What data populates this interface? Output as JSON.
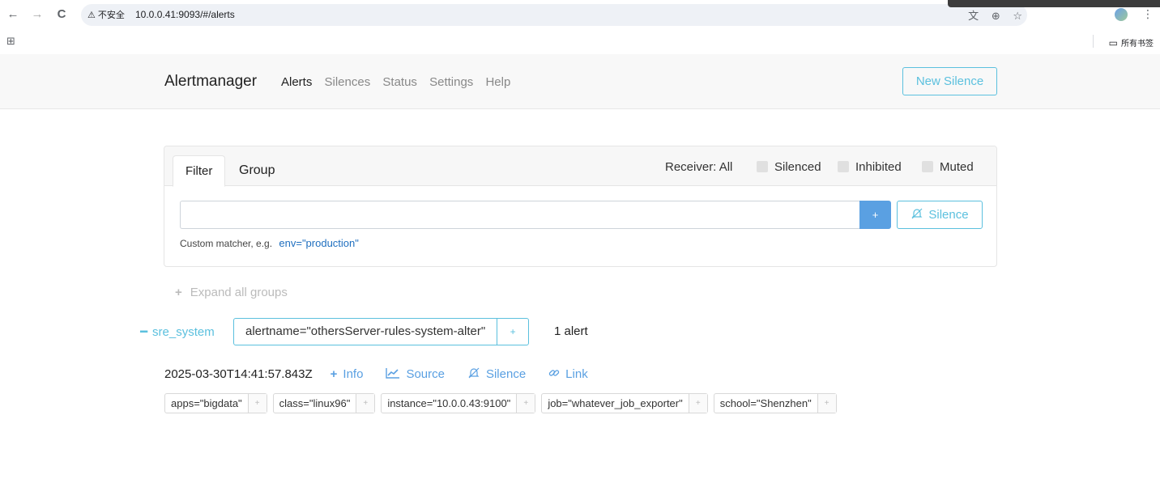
{
  "browser": {
    "back_icon": "←",
    "forward_icon": "→",
    "reload_icon": "C",
    "security_warning": "⚠ 不安全",
    "url": "10.0.0.41:9093/#/alerts",
    "translate_icon": "文",
    "zoom_icon": "⊕",
    "star_icon": "☆",
    "menu_icon": "⋮",
    "apps_icon": "⊞",
    "bookmarks_folder_icon": "▭",
    "bookmarks_label": "所有书签"
  },
  "navbar": {
    "brand": "Alertmanager",
    "links": [
      "Alerts",
      "Silences",
      "Status",
      "Settings",
      "Help"
    ],
    "active": "Alerts",
    "new_silence": "New Silence"
  },
  "filter": {
    "tabs": [
      "Filter",
      "Group"
    ],
    "receiver": "Receiver: All",
    "checkboxes": [
      "Silenced",
      "Inhibited",
      "Muted"
    ],
    "input_value": "",
    "add_button": "+",
    "silence_button": "Silence",
    "hint": "Custom matcher, e.g.",
    "hint_example": "env=\"production\""
  },
  "expand_all": "Expand all groups",
  "group": {
    "name": "sre_system",
    "matcher": "alertname=\"othersServer-rules-system-alter\"",
    "add": "+",
    "count": "1 alert"
  },
  "alert": {
    "timestamp": "2025-03-30T14:41:57.843Z",
    "actions": [
      "Info",
      "Source",
      "Silence",
      "Link"
    ],
    "labels": [
      "apps=\"bigdata\"",
      "class=\"linux96\"",
      "instance=\"10.0.0.43:9100\"",
      "job=\"whatever_job_exporter\"",
      "school=\"Shenzhen\""
    ]
  },
  "colors": {
    "accent": "#5bc0de",
    "primary": "#5aa0e2",
    "link": "#1f6fbf"
  }
}
